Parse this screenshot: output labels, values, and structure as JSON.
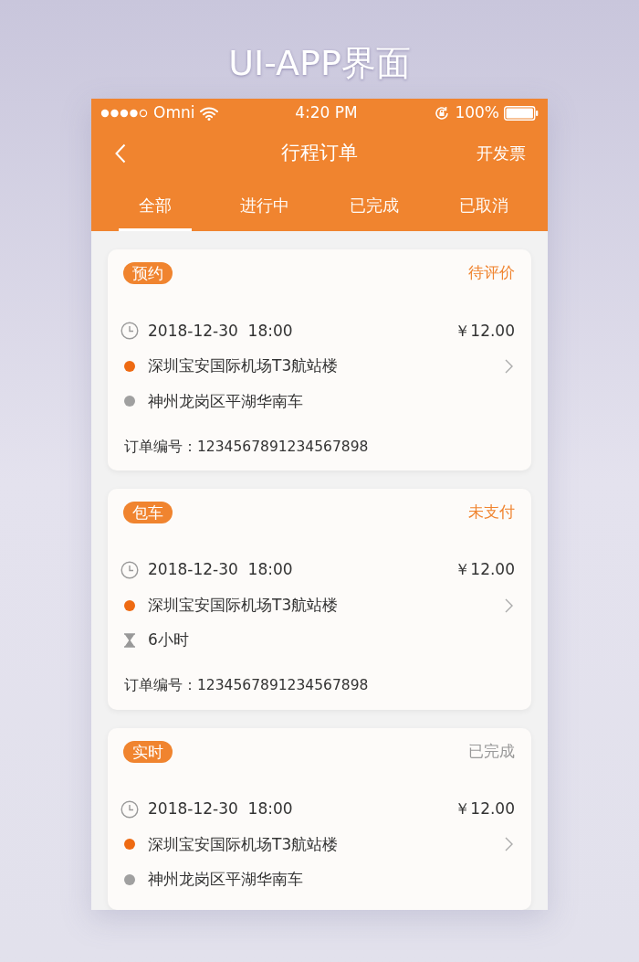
{
  "page_title": "UI-APP界面",
  "status_bar": {
    "carrier": "Omni",
    "time": "4:20 PM",
    "battery": "100%"
  },
  "nav": {
    "title": "行程订单",
    "action": "开发票"
  },
  "tabs": [
    {
      "label": "全部",
      "selected": true
    },
    {
      "label": "进行中",
      "selected": false
    },
    {
      "label": "已完成",
      "selected": false
    },
    {
      "label": "已取消",
      "selected": false
    }
  ],
  "orders": [
    {
      "tag": "预约",
      "status": "待评价",
      "status_highlight": true,
      "rows": [
        {
          "kind": "time",
          "text": "2018-12-30  18:00",
          "price": "￥12.00"
        },
        {
          "kind": "origin",
          "text": "深圳宝安国际机场T3航站楼"
        },
        {
          "kind": "destination",
          "text": "神州龙岗区平湖华南车"
        }
      ],
      "order_label": "订单编号：",
      "order_no": "1234567891234567898"
    },
    {
      "tag": "包车",
      "status": "未支付",
      "status_highlight": true,
      "rows": [
        {
          "kind": "time",
          "text": "2018-12-30  18:00",
          "price": "￥12.00"
        },
        {
          "kind": "origin",
          "text": "深圳宝安国际机场T3航站楼"
        },
        {
          "kind": "duration",
          "text": "6小时"
        }
      ],
      "order_label": "订单编号：",
      "order_no": "1234567891234567898"
    },
    {
      "tag": "实时",
      "status": "已完成",
      "status_highlight": false,
      "rows": [
        {
          "kind": "time",
          "text": "2018-12-30  18:00",
          "price": "￥12.00"
        },
        {
          "kind": "origin",
          "text": "深圳宝安国际机场T3航站楼"
        },
        {
          "kind": "destination",
          "text": "神州龙岗区平湖华南车"
        }
      ]
    }
  ]
}
